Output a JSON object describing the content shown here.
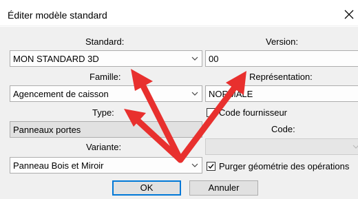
{
  "dialog": {
    "title": "Éditer modèle standard",
    "close_glyph": "✕"
  },
  "standard": {
    "label": "Standard:",
    "value": "MON STANDARD 3D"
  },
  "version": {
    "label": "Version:",
    "value": "00"
  },
  "famille": {
    "label": "Famille:",
    "value": "Agencement de caisson"
  },
  "representation": {
    "label": "Représentation:",
    "value": "NORMALE"
  },
  "type": {
    "label": "Type:",
    "value": "Panneaux portes"
  },
  "code_fournisseur": {
    "label": "Code fournisseur",
    "checked": false
  },
  "code": {
    "label": "Code:",
    "value": ""
  },
  "variante": {
    "label": "Variante:",
    "value": "Panneau Bois et Miroir"
  },
  "purger": {
    "label": "Purger géométrie des opérations",
    "checked": true
  },
  "buttons": {
    "ok": "OK",
    "annuler": "Annuler"
  },
  "colors": {
    "arrow": "#e8302e",
    "accent": "#0078d7"
  },
  "icons": [
    "close-icon",
    "chevron-down-icon",
    "checkmark-icon"
  ]
}
